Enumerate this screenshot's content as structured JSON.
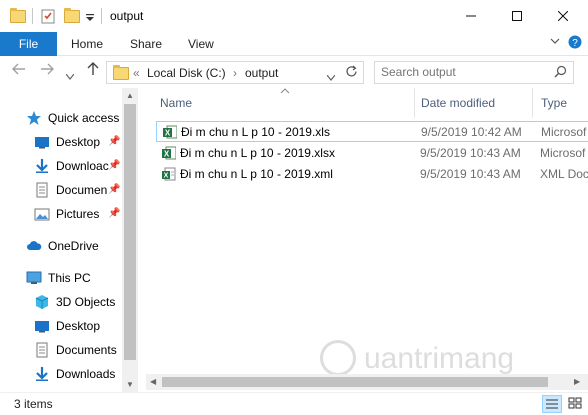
{
  "window": {
    "title": "output",
    "controls": {
      "minimize": "—",
      "maximize": "☐",
      "close": "✕"
    }
  },
  "ribbon": {
    "file_label": "File",
    "tabs": [
      "Home",
      "Share",
      "View"
    ]
  },
  "address_bar": {
    "overflow": "«",
    "segments": [
      "Local Disk (C:)",
      "output"
    ],
    "separator": "›"
  },
  "search": {
    "placeholder": "Search output"
  },
  "nav_pane": {
    "quick_access": {
      "label": "Quick access",
      "items": [
        {
          "label": "Desktop",
          "icon": "desktop-icon",
          "pinned": true
        },
        {
          "label": "Downloac",
          "icon": "downloads-icon",
          "pinned": true
        },
        {
          "label": "Documen",
          "icon": "documents-icon",
          "pinned": true
        },
        {
          "label": "Pictures",
          "icon": "pictures-icon",
          "pinned": true
        }
      ]
    },
    "onedrive": {
      "label": "OneDrive"
    },
    "this_pc": {
      "label": "This PC",
      "items": [
        {
          "label": "3D Objects",
          "icon": "3d-objects-icon"
        },
        {
          "label": "Desktop",
          "icon": "desktop-icon"
        },
        {
          "label": "Documents",
          "icon": "documents-icon"
        },
        {
          "label": "Downloads",
          "icon": "downloads-icon"
        }
      ]
    }
  },
  "file_list": {
    "columns": [
      "Name",
      "Date modified",
      "Type"
    ],
    "rows": [
      {
        "name": "Đi m chu n L p 10 - 2019.xls",
        "date": "9/5/2019 10:42 AM",
        "type": "Microsof",
        "selected": true
      },
      {
        "name": "Đi m chu n L p 10 - 2019.xlsx",
        "date": "9/5/2019 10:43 AM",
        "type": "Microsof",
        "selected": false
      },
      {
        "name": "Đi m chu n L p 10 - 2019.xml",
        "date": "9/5/2019 10:43 AM",
        "type": "XML Doc",
        "selected": false
      }
    ]
  },
  "status": {
    "item_count": "3 items"
  },
  "colors": {
    "accent": "#1979ca",
    "column_header": "#4c607a",
    "selection_border": "#99d1ff",
    "excel_green": "#217346"
  }
}
